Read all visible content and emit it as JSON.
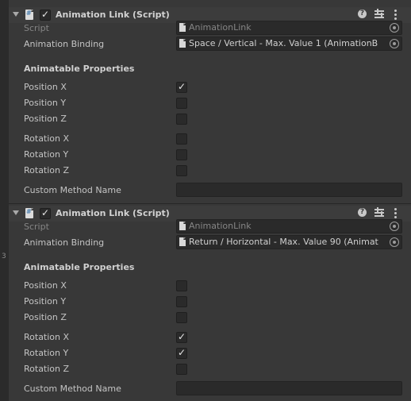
{
  "components": [
    {
      "title": "Animation Link (Script)",
      "enabled": true,
      "script_label": "Script",
      "script_value": "AnimationLink",
      "binding_label": "Animation Binding",
      "binding_value": "Space / Vertical - Max. Value 1 (AnimationB",
      "section_header": "Animatable Properties",
      "properties": [
        {
          "label": "Position X",
          "checked": true
        },
        {
          "label": "Position Y",
          "checked": false
        },
        {
          "label": "Position Z",
          "checked": false
        },
        {
          "label": "Rotation X",
          "checked": false
        },
        {
          "label": "Rotation Y",
          "checked": false
        },
        {
          "label": "Rotation Z",
          "checked": false
        }
      ],
      "custom_method_label": "Custom Method Name",
      "custom_method_value": ""
    },
    {
      "title": "Animation Link (Script)",
      "enabled": true,
      "script_label": "Script",
      "script_value": "AnimationLink",
      "binding_label": "Animation Binding",
      "binding_value": "Return / Horizontal - Max. Value 90 (Animat",
      "section_header": "Animatable Properties",
      "properties": [
        {
          "label": "Position X",
          "checked": false
        },
        {
          "label": "Position Y",
          "checked": false
        },
        {
          "label": "Position Z",
          "checked": false
        },
        {
          "label": "Rotation X",
          "checked": true
        },
        {
          "label": "Rotation Y",
          "checked": true
        },
        {
          "label": "Rotation Z",
          "checked": false
        }
      ],
      "custom_method_label": "Custom Method Name",
      "custom_method_value": ""
    }
  ],
  "icons": {
    "help": "help-icon",
    "presets": "presets-icon",
    "more": "more-options-icon",
    "foldout": "foldout-arrow-icon",
    "script": "script-file-icon",
    "picker": "object-picker-icon"
  },
  "header_help_glyph": "?",
  "check_glyph": "✓",
  "left_strip_mark": "3",
  "colors": {
    "background": "#383838",
    "header": "#3c3c3c",
    "field": "#2a2a2a",
    "text": "#c4c4c4",
    "dim_text": "#858585"
  }
}
